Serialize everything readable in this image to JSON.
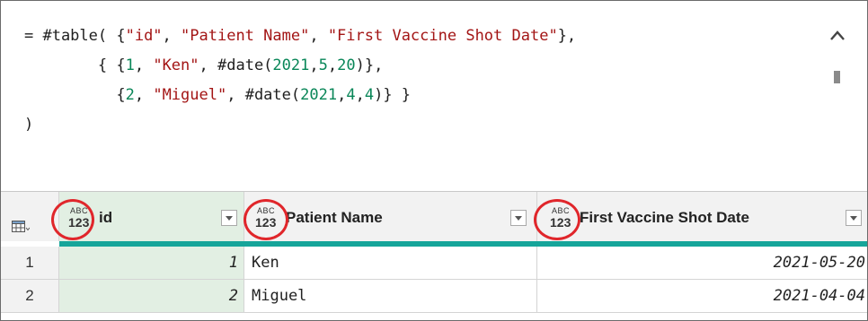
{
  "formula": {
    "prefix": "= #table( {",
    "col_id": "\"id\"",
    "col_patient": "\"Patient Name\"",
    "col_date": "\"First Vaccine Shot Date\"",
    "row1_id": "1",
    "row1_name": "\"Ken\"",
    "row1_year": "2021",
    "row1_month": "5",
    "row1_day": "20",
    "row2_id": "2",
    "row2_name": "\"Miguel\"",
    "row2_year": "2021",
    "row2_month": "4",
    "row2_day": "4",
    "date_fn": "#date(",
    "closing": ")"
  },
  "grid": {
    "columns": [
      {
        "type_top": "ABC",
        "type_bottom": "123",
        "name": "id"
      },
      {
        "type_top": "ABC",
        "type_bottom": "123",
        "name": "Patient Name"
      },
      {
        "type_top": "ABC",
        "type_bottom": "123",
        "name": "First Vaccine Shot Date"
      }
    ],
    "rows": [
      {
        "num": "1",
        "id": "1",
        "name": "Ken",
        "date": "2021-05-20"
      },
      {
        "num": "2",
        "id": "2",
        "name": "Miguel",
        "date": "2021-04-04"
      }
    ]
  },
  "colors": {
    "highlight_ring": "#e0262b",
    "teal_bar": "#16a59a",
    "selected_column": "#e2efe3",
    "string_literal": "#a31515",
    "number_literal": "#098658"
  }
}
